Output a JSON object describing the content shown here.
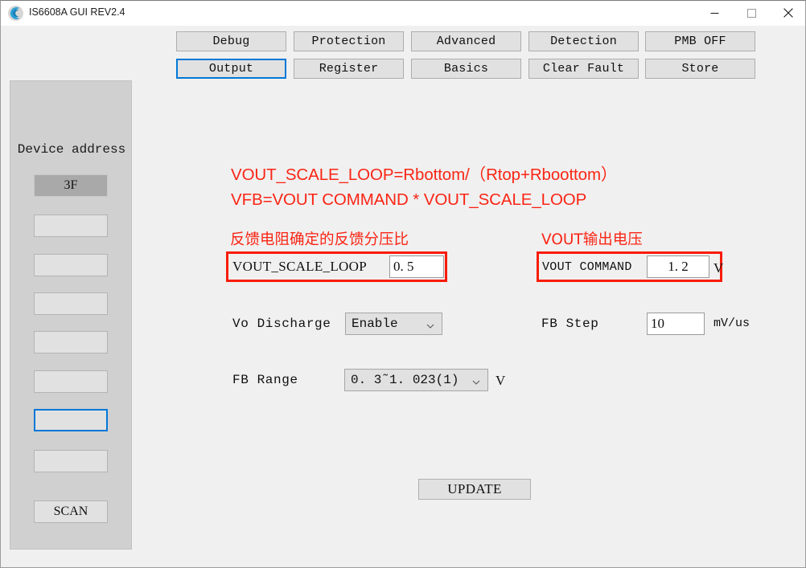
{
  "window": {
    "title": "IS6608A GUI REV2.4",
    "icon": "app-swoosh-icon",
    "minimize": "—",
    "maximize": "□",
    "close": "✕"
  },
  "tabs": [
    {
      "label": "Debug",
      "selected": false
    },
    {
      "label": "Protection",
      "selected": false
    },
    {
      "label": "Advanced",
      "selected": false
    },
    {
      "label": "Detection",
      "selected": false
    },
    {
      "label": "PMB OFF",
      "selected": false
    },
    {
      "label": "Output",
      "selected": true
    },
    {
      "label": "Register",
      "selected": false
    },
    {
      "label": "Basics",
      "selected": false
    },
    {
      "label": "Clear Fault",
      "selected": false
    },
    {
      "label": "Store",
      "selected": false
    }
  ],
  "device_panel": {
    "heading": "Device address",
    "slots": [
      {
        "label": "3F",
        "state": "active"
      },
      {
        "label": "",
        "state": "empty"
      },
      {
        "label": "",
        "state": "empty"
      },
      {
        "label": "",
        "state": "empty"
      },
      {
        "label": "",
        "state": "empty"
      },
      {
        "label": "",
        "state": "empty"
      },
      {
        "label": "",
        "state": "focused"
      },
      {
        "label": "",
        "state": "empty"
      }
    ],
    "scan_label": "SCAN"
  },
  "notes": {
    "formula1": "VOUT_SCALE_LOOP=Rbottom/（Rtop+Rboottom）",
    "formula2": "VFB=VOUT COMMAND * VOUT_SCALE_LOOP",
    "caption_left": "反馈电阻确定的反馈分压比",
    "caption_right": "VOUT输出电压",
    "accent_color": "#fa2515"
  },
  "form": {
    "vout_scale_loop": {
      "label": "VOUT_SCALE_LOOP",
      "value": "0. 5"
    },
    "vout_command": {
      "label": "VOUT COMMAND",
      "value": "1. 2",
      "unit": "V"
    },
    "vo_discharge": {
      "label": "Vo Discharge",
      "value": "Enable"
    },
    "fb_step": {
      "label": "FB Step",
      "value": "10",
      "unit": "mV/us"
    },
    "fb_range": {
      "label": "FB Range",
      "value": "0. 3˜1. 023(1)",
      "unit": "V"
    },
    "update_label": "UPDATE"
  }
}
